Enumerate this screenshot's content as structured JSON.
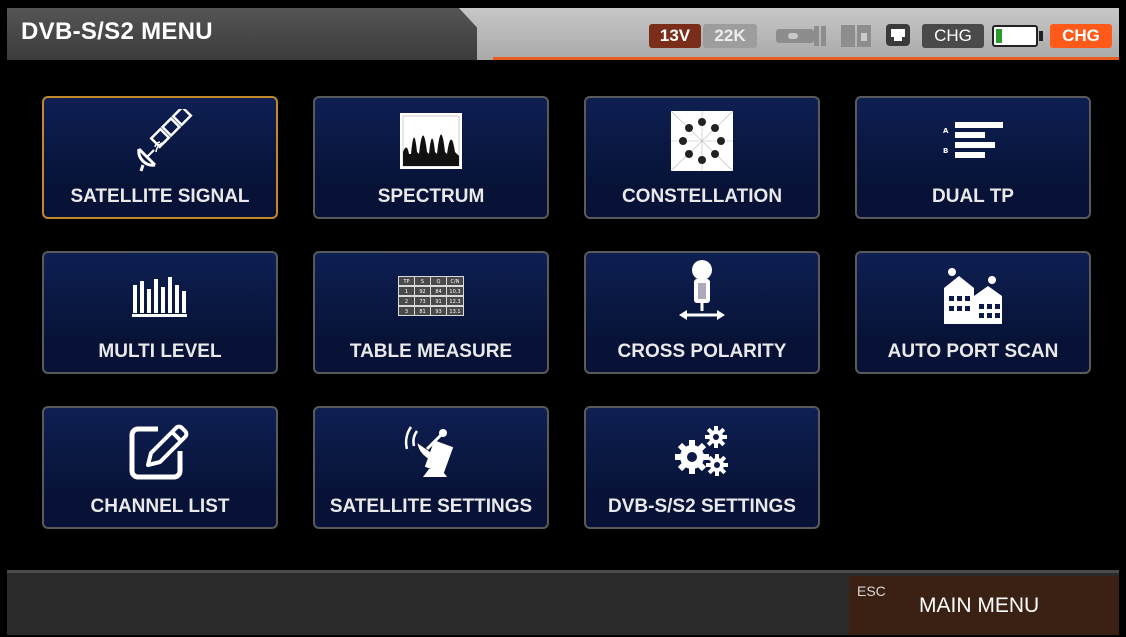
{
  "header": {
    "title": "DVB-S/S2 MENU",
    "lnb_voltage": "13V",
    "tone": "22K",
    "charge_label": "CHG",
    "charge_alert": "CHG",
    "battery_level": 0.15,
    "colors": {
      "accent": "#e85b1d",
      "voltage_bg": "#7a2e1a",
      "alert_bg": "#ff5a1a"
    }
  },
  "menu": {
    "tiles": [
      {
        "label": "SATELLITE SIGNAL",
        "icon": "satellite-dish-icon",
        "selected": true
      },
      {
        "label": "SPECTRUM",
        "icon": "spectrum-icon"
      },
      {
        "label": "CONSTELLATION",
        "icon": "constellation-icon"
      },
      {
        "label": "DUAL TP",
        "icon": "dual-tp-icon"
      },
      {
        "label": "MULTI LEVEL",
        "icon": "multi-level-icon"
      },
      {
        "label": "TABLE MEASURE",
        "icon": "table-measure-icon",
        "table": {
          "headers": [
            "TP",
            "S",
            "Q",
            "C/N"
          ],
          "rows": [
            [
              "1",
              "92",
              "84",
              "10.3"
            ],
            [
              "2",
              "73",
              "91",
              "12.3"
            ],
            [
              "3",
              "81",
              "93",
              "13.1"
            ]
          ]
        }
      },
      {
        "label": "CROSS POLARITY",
        "icon": "cross-polarity-icon"
      },
      {
        "label": "AUTO PORT SCAN",
        "icon": "auto-port-scan-icon"
      },
      {
        "label": "CHANNEL LIST",
        "icon": "edit-icon"
      },
      {
        "label": "SATELLITE SETTINGS",
        "icon": "satellite-settings-icon"
      },
      {
        "label": "DVB-S/S2 SETTINGS",
        "icon": "gears-icon"
      }
    ]
  },
  "footer": {
    "esc_label": "ESC",
    "main_menu_label": "MAIN MENU"
  }
}
